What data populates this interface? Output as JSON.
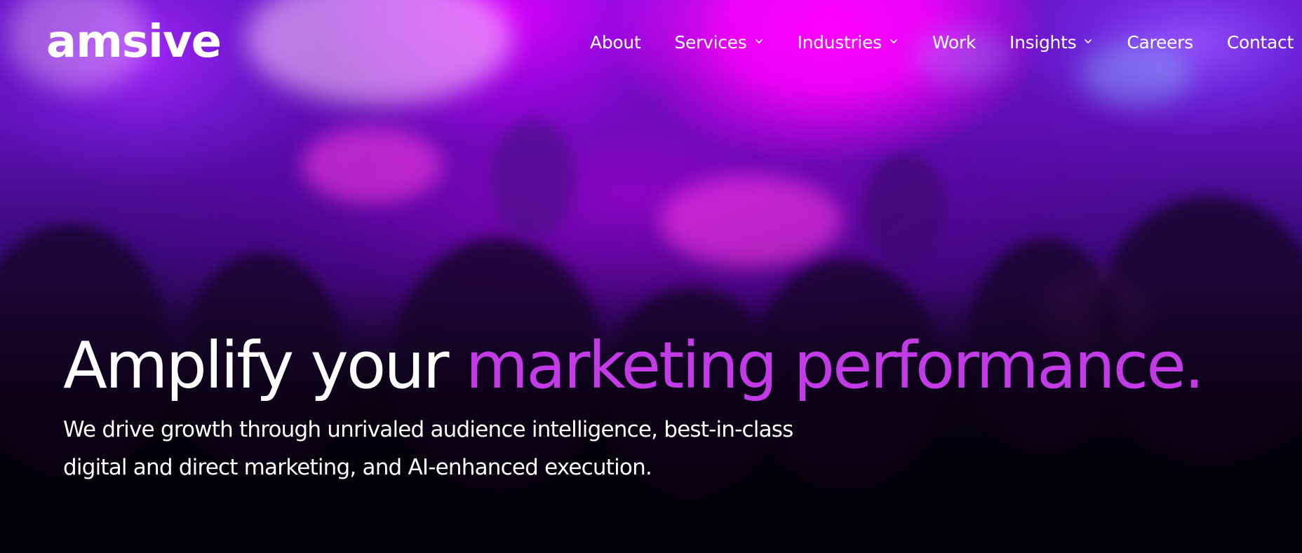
{
  "brand": {
    "logo_text": "amsive"
  },
  "nav": {
    "items": [
      {
        "label": "About",
        "has_dropdown": false
      },
      {
        "label": "Services",
        "has_dropdown": true
      },
      {
        "label": "Industries",
        "has_dropdown": true
      },
      {
        "label": "Work",
        "has_dropdown": false
      },
      {
        "label": "Insights",
        "has_dropdown": true
      },
      {
        "label": "Careers",
        "has_dropdown": false
      },
      {
        "label": "Contact",
        "has_dropdown": false
      }
    ]
  },
  "hero": {
    "headline_lead": "Amplify your ",
    "headline_accent": "marketing performance.",
    "subhead": "We drive growth through unrivaled audience intelligence, best-in-class digital and direct marketing, and AI-enhanced execution."
  },
  "colors": {
    "accent": "#c23be6",
    "text": "#ffffff",
    "background_dark": "#05030a"
  },
  "icons": {
    "dropdown": "chevron-down-icon"
  }
}
